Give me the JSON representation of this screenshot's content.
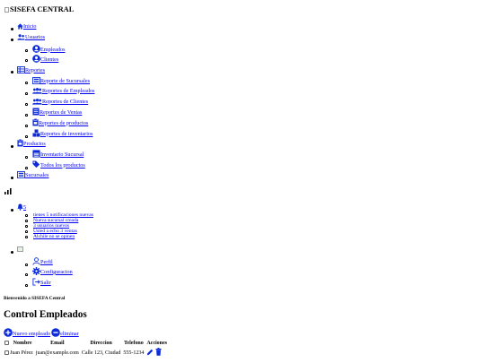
{
  "brand": {
    "name": "SISEFA CENTRAL"
  },
  "nav": {
    "inicio": "Inicio",
    "usuarios": "Usuarios",
    "empleados": "Empleados",
    "clientes": "Clientes",
    "reportes": "Reportes",
    "rep_sucursales": "Reporte de Sucursales",
    "rep_empleados": "Reportes de Empleados",
    "rep_clientes": "Reportes de Clientes",
    "rep_ventas": "Reportes de Ventas",
    "rep_productos": "Reportes de productos",
    "rep_inventarios": "Reportes de inventarios",
    "productos": "Productos",
    "inventario_sucursal": "Inventario Sucursal",
    "todos_productos": "Todos los productos",
    "sucursales": "Sucursales"
  },
  "notifications": {
    "count": "5",
    "items": [
      "tienes 5 notificaciones nuevas",
      "Nueva sucursal creada",
      "3 usuarios nuevos",
      "Usted a echo 3 ventas",
      "Alchile no se opinen"
    ]
  },
  "user_menu": {
    "perfil": "Perfil",
    "configuracion": "Configuracion",
    "salir": "Salir"
  },
  "welcome": "Bienvenido a SISEFA Central",
  "page_title": "Control Empleados",
  "actions": {
    "new": "Nuevo empleado",
    "delete": "eliminar"
  },
  "table": {
    "headers": [
      "Nombre",
      "Email",
      "Direccion",
      "Telefono",
      "Acciones"
    ],
    "rows": [
      {
        "name": "Juan Pérez",
        "email": "juan@example.com",
        "address": "Calle 123, Ciudad",
        "phone": "555-1234"
      }
    ]
  },
  "colors": {
    "icon": "#0d2bd8",
    "link": "#0000ee"
  }
}
